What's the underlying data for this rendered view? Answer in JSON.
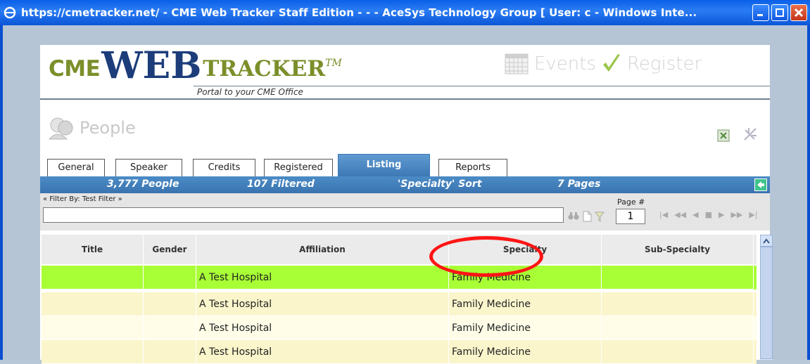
{
  "window": {
    "title": "https://cmetracker.net/ - CME Web Tracker Staff Edition - - - AceSys Technology Group [ User: c - Windows Inte...",
    "accent": "#0b56d8"
  },
  "header": {
    "logo_cme": "CME",
    "logo_web": "WEB",
    "logo_tracker": "TRACKER",
    "logo_tm": "TM",
    "tagline": "Portal to your CME Office",
    "nav_events": "Events",
    "nav_register": "Register"
  },
  "section": {
    "title": "People"
  },
  "tabs": [
    {
      "label": "General"
    },
    {
      "label": "Speaker"
    },
    {
      "label": "Credits"
    },
    {
      "label": "Registered"
    },
    {
      "label": "Listing"
    },
    {
      "label": "Reports"
    }
  ],
  "status": {
    "people": "3,777 People",
    "filtered": "107 Filtered",
    "sort": "'Specialty' Sort",
    "pages": "7 Pages"
  },
  "filter": {
    "label": "« Filter By: Test Filter »",
    "value": "",
    "page_label": "Page #",
    "page_value": "1"
  },
  "grid": {
    "columns": [
      "Title",
      "Gender",
      "Affiliation",
      "Specialty",
      "Sub-Specialty"
    ],
    "rows": [
      [
        "",
        "",
        "A Test Hospital",
        "Family Medicine",
        ""
      ],
      [
        "",
        "",
        "A Test Hospital",
        "Family Medicine",
        ""
      ],
      [
        "",
        "",
        "A Test Hospital",
        "Family Medicine",
        ""
      ],
      [
        "",
        "",
        "A Test Hospital",
        "Family Medicine",
        ""
      ]
    ],
    "selected_row_color": "#a8ff35"
  }
}
